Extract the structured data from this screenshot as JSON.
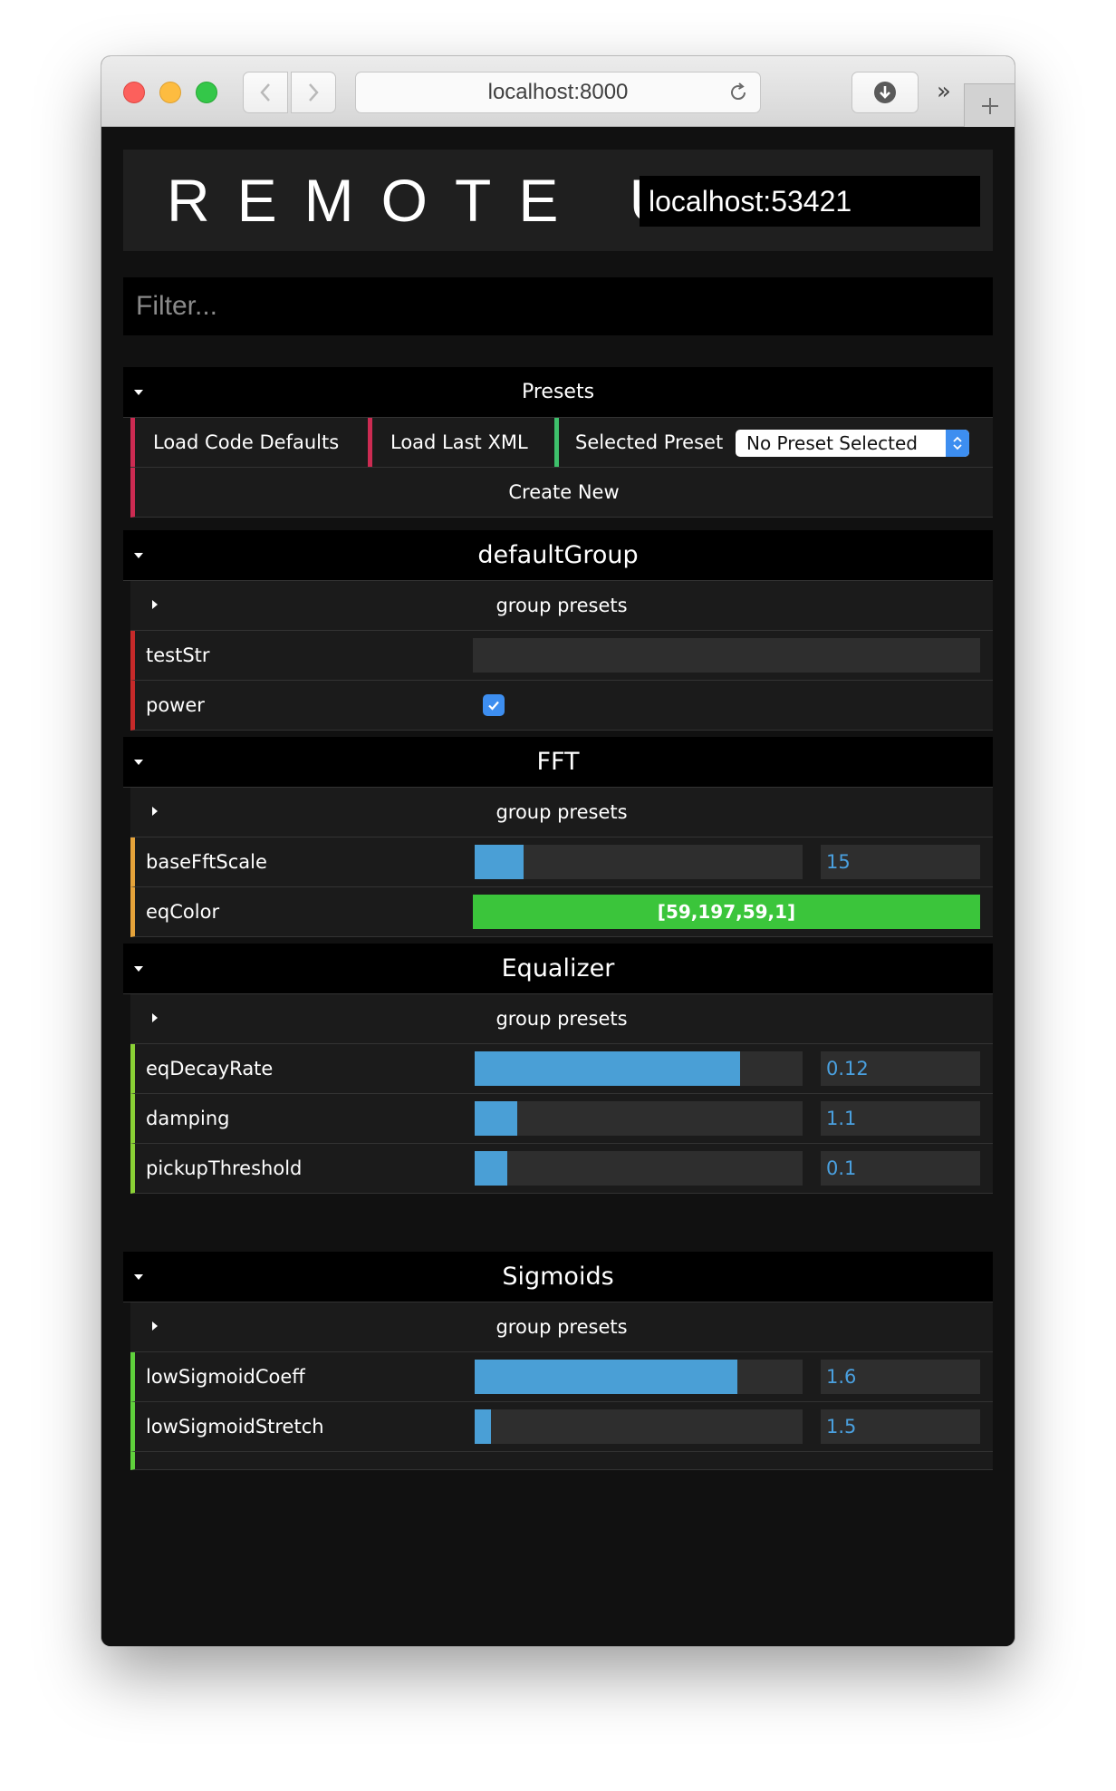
{
  "browser": {
    "url": "localhost:8000"
  },
  "app": {
    "title": "REMOTE UI",
    "host": "localhost:53421",
    "filter_placeholder": "Filter..."
  },
  "presets": {
    "title": "Presets",
    "load_defaults_label": "Load Code Defaults",
    "load_xml_label": "Load Last XML",
    "selected_label": "Selected Preset",
    "selected_value": "No Preset Selected",
    "create_label": "Create New"
  },
  "groups": [
    {
      "name": "defaultGroup",
      "presets_label": "group presets",
      "params": [
        {
          "name": "testStr",
          "type": "string",
          "value": ""
        },
        {
          "name": "power",
          "type": "bool",
          "value": true
        }
      ]
    },
    {
      "name": "FFT",
      "presets_label": "group presets",
      "params": [
        {
          "name": "baseFftScale",
          "type": "slider",
          "value": "15",
          "fill": 0.15
        },
        {
          "name": "eqColor",
          "type": "color",
          "value": "[59,197,59,1]",
          "color": "#3bc53b"
        }
      ]
    },
    {
      "name": "Equalizer",
      "presets_label": "group presets",
      "params": [
        {
          "name": "eqDecayRate",
          "type": "slider",
          "value": "0.12",
          "fill": 0.81
        },
        {
          "name": "damping",
          "type": "slider",
          "value": "1.1",
          "fill": 0.13
        },
        {
          "name": "pickupThreshold",
          "type": "slider",
          "value": "0.1",
          "fill": 0.1
        }
      ]
    },
    {
      "name": "Sigmoids",
      "presets_label": "group presets",
      "params": [
        {
          "name": "lowSigmoidCoeff",
          "type": "slider",
          "value": "1.6",
          "fill": 0.8
        },
        {
          "name": "lowSigmoidStretch",
          "type": "slider",
          "value": "1.5",
          "fill": 0.05
        }
      ]
    }
  ],
  "colors": {
    "preset_accent": "#cc2b52",
    "default_group_accent": "#c62a2a",
    "fft_accent": "#e5a33a",
    "equalizer_accent": "#8ad135",
    "sigmoids_accent": "#5fd13c",
    "slider_fill": "#4a9fd6"
  }
}
